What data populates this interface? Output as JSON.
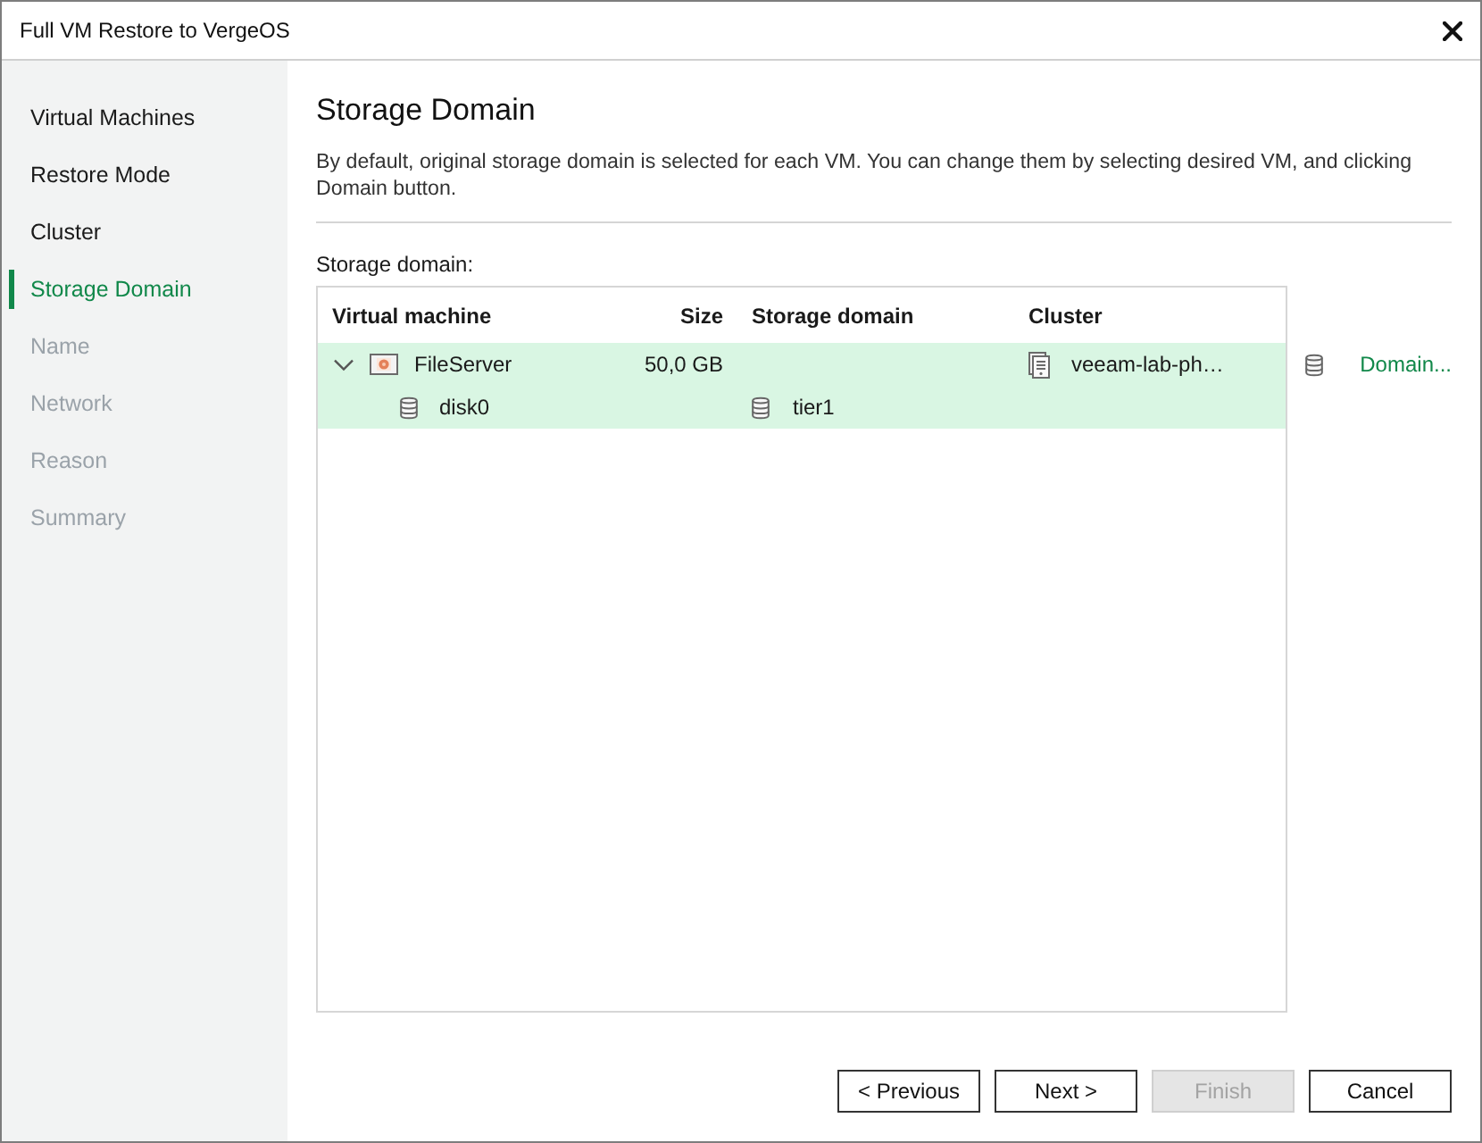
{
  "window": {
    "title": "Full VM Restore to VergeOS"
  },
  "steps": [
    {
      "label": "Virtual Machines",
      "selected": false,
      "disabled": false
    },
    {
      "label": "Restore Mode",
      "selected": false,
      "disabled": false
    },
    {
      "label": "Cluster",
      "selected": false,
      "disabled": false
    },
    {
      "label": "Storage Domain",
      "selected": true,
      "disabled": false
    },
    {
      "label": "Name",
      "selected": false,
      "disabled": true
    },
    {
      "label": "Network",
      "selected": false,
      "disabled": true
    },
    {
      "label": "Reason",
      "selected": false,
      "disabled": true
    },
    {
      "label": "Summary",
      "selected": false,
      "disabled": true
    }
  ],
  "page": {
    "title": "Storage Domain",
    "description": "By default, original storage domain is selected for each VM. You can change them by selecting desired VM, and clicking Domain button."
  },
  "storage": {
    "label": "Storage domain:",
    "columns": [
      "Virtual machine",
      "Size",
      "Storage domain",
      "Cluster"
    ],
    "rows": [
      {
        "kind": "vm",
        "name": "FileServer",
        "size": "50,0 GB",
        "cluster": "veeam-lab-ph…",
        "expanded": true,
        "selected": true,
        "children": [
          {
            "kind": "disk",
            "name": "disk0",
            "storage_domain": "tier1",
            "selected": true
          }
        ]
      }
    ],
    "domain_button": "Domain..."
  },
  "buttons": [
    {
      "label": "< Previous",
      "disabled": false
    },
    {
      "label": "Next >",
      "disabled": false
    },
    {
      "label": "Finish",
      "disabled": true
    },
    {
      "label": "Cancel",
      "disabled": false
    }
  ]
}
